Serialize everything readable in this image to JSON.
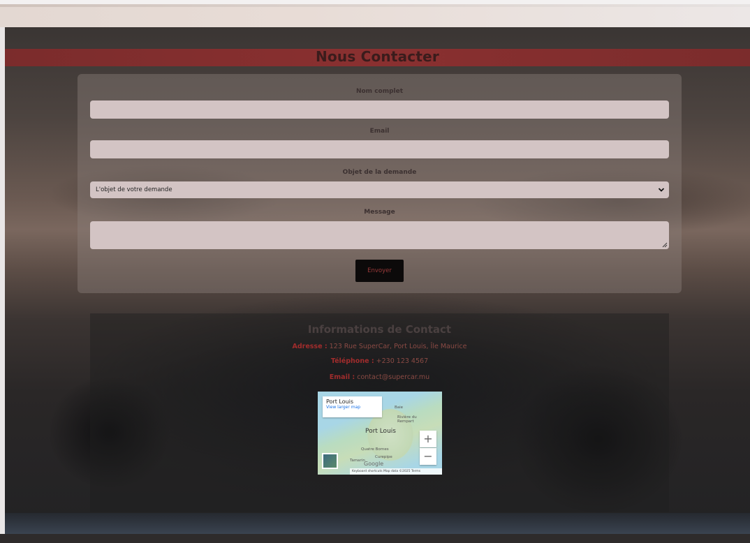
{
  "page": {
    "title": "Nous Contacter"
  },
  "form": {
    "name_label": "Nom complet",
    "name_value": "",
    "email_label": "Email",
    "email_value": "",
    "subject_label": "Objet de la demande",
    "subject_selected": "L'objet de votre demande",
    "message_label": "Message",
    "message_value": "",
    "submit_label": "Envoyer"
  },
  "contact": {
    "title": "Informations de Contact",
    "address_label": "Adresse :",
    "address_value": "123 Rue SuperCar, Port Louis, Île Maurice",
    "phone_label": "Téléphone :",
    "phone_value": "+230 123 4567",
    "email_label": "Email :",
    "email_value": "contact@supercar.mu"
  },
  "map": {
    "popup_title": "Port Louis",
    "popup_link": "View larger map",
    "city_label": "Port Louis",
    "places": [
      "Baie",
      "Rivière du Rempart",
      "Quatre Bornes",
      "Curepipe",
      "Tamarin"
    ],
    "zoom_in": "+",
    "zoom_out": "−",
    "footer": "Keyboard shortcuts   Map data ©2025   Terms",
    "logo": "Google"
  },
  "colors": {
    "accent": "#8a3030",
    "button_text": "#9b3a3a",
    "input_bg": "#d3c4c4"
  },
  "icons": {
    "select": "chevron-down-icon",
    "resize": "resize-handle-icon"
  }
}
